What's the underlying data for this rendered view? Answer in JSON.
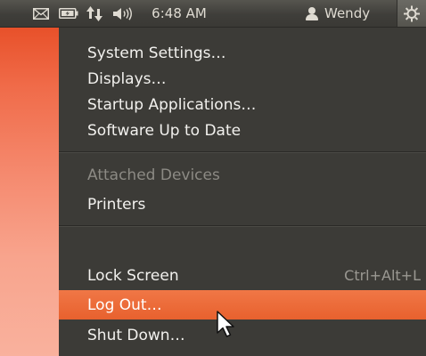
{
  "panel": {
    "clock": "6:48 AM",
    "user_name": "Wendy",
    "icons": {
      "mail": "mail-icon",
      "battery": "battery-icon",
      "network": "network-icon",
      "volume": "volume-icon",
      "user": "user-icon",
      "session": "power-icon"
    }
  },
  "menu": {
    "items": [
      {
        "label": "System Settings…"
      },
      {
        "label": "Displays…"
      },
      {
        "label": "Startup Applications…"
      },
      {
        "label": "Software Up to Date"
      },
      {
        "label": "Attached Devices",
        "disabled": true
      },
      {
        "label": "Printers"
      },
      {
        "label": "Lock Screen",
        "shortcut": "Ctrl+Alt+L"
      },
      {
        "label": "Log Out…",
        "highlighted": true
      },
      {
        "label": "Shut Down…"
      }
    ]
  },
  "colors": {
    "panel": "#3c3b37",
    "menu_background": "#3c3b37",
    "highlight": "#e8612e",
    "text": "#f2f1ee",
    "disabled_text": "#8c8a84"
  }
}
